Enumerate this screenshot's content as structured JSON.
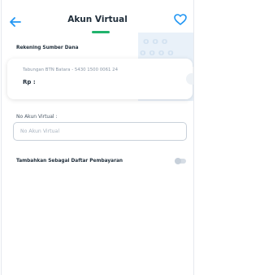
{
  "header": {
    "title": "Akun Virtual",
    "back_icon": "arrow-left-icon",
    "favorite_icon": "heart-outline-icon"
  },
  "source_account": {
    "label": "Rekening Sumber Dana",
    "account_text": "Tabungan BTN Batara - 5430 1500 0061 24",
    "amount_prefix": "Rp :"
  },
  "virtual_account": {
    "label": "No Akun Virtual :",
    "placeholder": "No Akun Virtual",
    "value": ""
  },
  "payment_list": {
    "label": "Tambahkan Sebagai Daftar Pembayaran",
    "enabled": false
  },
  "colors": {
    "accent": "#2196f3",
    "underline": "#21b36c",
    "text": "#1f2d3a"
  }
}
